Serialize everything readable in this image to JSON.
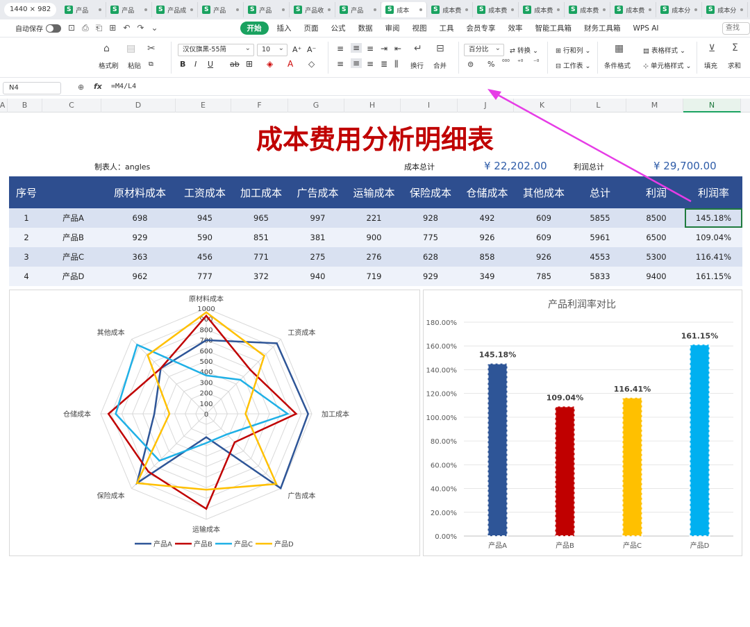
{
  "tabbar": {
    "dimension_chip": "1440 × 982",
    "tabs": [
      {
        "label": "产品"
      },
      {
        "label": "产品"
      },
      {
        "label": "产品成"
      },
      {
        "label": "产品"
      },
      {
        "label": "产品"
      },
      {
        "label": "产品收"
      },
      {
        "label": "产品"
      },
      {
        "label": "成本",
        "active": true
      },
      {
        "label": "成本费"
      },
      {
        "label": "成本费"
      },
      {
        "label": "成本费"
      },
      {
        "label": "成本费"
      },
      {
        "label": "成本费"
      },
      {
        "label": "成本分"
      },
      {
        "label": "成本分"
      }
    ]
  },
  "menubar": {
    "autosave_label": "自动保存",
    "items": [
      "开始",
      "插入",
      "页面",
      "公式",
      "数据",
      "审阅",
      "视图",
      "工具",
      "会员专享",
      "效率",
      "智能工具箱",
      "财务工具箱",
      "WPS AI"
    ],
    "search_placeholder": "查找"
  },
  "ribbon": {
    "format_painter": "格式刷",
    "paste": "粘贴",
    "cut": "剪切",
    "font_name": "汉仪旗黑-55简",
    "font_size": "10",
    "number_format": "百分比",
    "convert": "转换",
    "rows_cols": "行和列",
    "table_style": "表格样式",
    "wrap": "换行",
    "merge": "合并",
    "worksheet": "工作表",
    "cond_format": "条件格式",
    "cell_style": "单元格样式",
    "fill": "填充",
    "sum": "求和"
  },
  "formulabar": {
    "cell_ref": "N4",
    "fx": "fx",
    "formula": "=M4/L4"
  },
  "columns": [
    "A",
    "B",
    "C",
    "D",
    "E",
    "F",
    "G",
    "H",
    "I",
    "J",
    "K",
    "L",
    "M",
    "N"
  ],
  "sheet": {
    "title": "成本费用分析明细表",
    "maker_label": "制表人：angles",
    "cost_total_label": "成本总计",
    "cost_total_value": "¥  22,202.00",
    "profit_total_label": "利润总计",
    "profit_total_value": "¥  29,700.00",
    "headers": [
      "序号",
      "",
      "原材料成本",
      "工资成本",
      "加工成本",
      "广告成本",
      "运输成本",
      "保险成本",
      "仓储成本",
      "其他成本",
      "总计",
      "利润",
      "利润率"
    ],
    "rows": [
      [
        "1",
        "产品A",
        "698",
        "945",
        "965",
        "997",
        "221",
        "928",
        "492",
        "609",
        "5855",
        "8500",
        "145.18%"
      ],
      [
        "2",
        "产品B",
        "929",
        "590",
        "851",
        "381",
        "900",
        "775",
        "926",
        "609",
        "5961",
        "6500",
        "109.04%"
      ],
      [
        "3",
        "产品C",
        "363",
        "456",
        "771",
        "275",
        "276",
        "628",
        "858",
        "926",
        "4553",
        "5300",
        "116.41%"
      ],
      [
        "4",
        "产品D",
        "962",
        "777",
        "372",
        "940",
        "719",
        "929",
        "349",
        "785",
        "5833",
        "9400",
        "161.15%"
      ]
    ]
  },
  "colors": {
    "header_blue": "#2e4e8f",
    "title_red": "#c00000",
    "product_a": "#2e5597",
    "product_b": "#c00000",
    "product_c": "#1fb0e6",
    "product_d": "#ffc000",
    "bar_b": "#c00000",
    "bar_c": "#ffc000",
    "bar_d": "#00b0f0"
  },
  "chart_data": [
    {
      "type": "radar",
      "categories": [
        "原材料成本",
        "工资成本",
        "加工成本",
        "广告成本",
        "运输成本",
        "保险成本",
        "仓储成本",
        "其他成本"
      ],
      "rlim": [
        0,
        1000
      ],
      "ticks": [
        "0",
        "100",
        "200",
        "300",
        "400",
        "500",
        "600",
        "700",
        "800",
        "900",
        "1000"
      ],
      "series": [
        {
          "name": "产品A",
          "values": [
            698,
            945,
            965,
            997,
            221,
            928,
            492,
            609
          ]
        },
        {
          "name": "产品B",
          "values": [
            929,
            590,
            851,
            381,
            900,
            775,
            926,
            609
          ]
        },
        {
          "name": "产品C",
          "values": [
            363,
            456,
            771,
            275,
            276,
            628,
            858,
            926
          ]
        },
        {
          "name": "产品D",
          "values": [
            962,
            777,
            372,
            940,
            719,
            929,
            349,
            785
          ]
        }
      ],
      "legend": "bottom"
    },
    {
      "type": "bar",
      "title": "产品利润率对比",
      "categories": [
        "产品A",
        "产品B",
        "产品C",
        "产品D"
      ],
      "values": [
        145.18,
        109.04,
        116.41,
        161.15
      ],
      "value_labels": [
        "145.18%",
        "109.04%",
        "116.41%",
        "161.15%"
      ],
      "ylim": [
        0,
        180
      ],
      "yticks": [
        "0.00%",
        "20.00%",
        "40.00%",
        "60.00%",
        "80.00%",
        "100.00%",
        "120.00%",
        "140.00%",
        "160.00%",
        "180.00%"
      ],
      "grid": true
    }
  ]
}
